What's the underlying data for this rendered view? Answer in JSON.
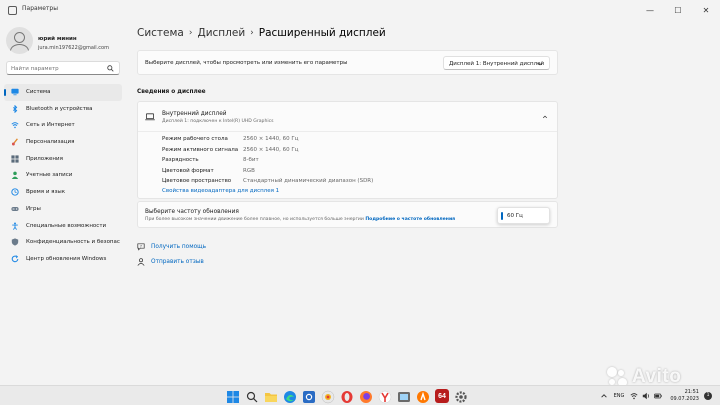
{
  "window": {
    "title": "Параметры",
    "controls": {
      "minimize": "—",
      "maximize": "☐",
      "close": "✕"
    }
  },
  "user": {
    "name": "юрий минин",
    "email": "jura.min197622@gmail.com"
  },
  "search": {
    "placeholder": "Найти параметр",
    "icon": "search-icon"
  },
  "sidebar": {
    "items": [
      {
        "label": "Система",
        "icon": "monitor-icon",
        "active": true
      },
      {
        "label": "Bluetooth и устройства",
        "icon": "bluetooth-icon"
      },
      {
        "label": "Сеть и Интернет",
        "icon": "wifi-icon"
      },
      {
        "label": "Персонализация",
        "icon": "brush-icon"
      },
      {
        "label": "Приложения",
        "icon": "apps-icon"
      },
      {
        "label": "Учетные записи",
        "icon": "person-icon"
      },
      {
        "label": "Время и язык",
        "icon": "globe-clock-icon"
      },
      {
        "label": "Игры",
        "icon": "gamepad-icon"
      },
      {
        "label": "Специальные возможности",
        "icon": "accessibility-icon"
      },
      {
        "label": "Конфиденциальность и безопас",
        "icon": "shield-icon"
      },
      {
        "label": "Центр обновления Windows",
        "icon": "update-icon"
      }
    ]
  },
  "breadcrumb": {
    "items": [
      "Система",
      "Дисплей"
    ],
    "current": "Расширенный дисплей",
    "separator": "›"
  },
  "display_select": {
    "prompt": "Выберите дисплей, чтобы просмотреть или изменить его параметры",
    "value": "Дисплей 1: Внутренний дисплей"
  },
  "display_info": {
    "section_title": "Сведения о дисплее",
    "title": "Внутренний дисплей",
    "subtitle": "Дисплей 1: подключен к Intel(R) UHD Graphics",
    "rows": [
      {
        "label": "Режим рабочего стола",
        "value": "2560 × 1440, 60 Гц"
      },
      {
        "label": "Режим активного сигнала",
        "value": "2560 × 1440, 60 Гц"
      },
      {
        "label": "Разрядность",
        "value": "8-бит"
      },
      {
        "label": "Цветовой формат",
        "value": "RGB"
      },
      {
        "label": "Цветовое пространство",
        "value": "Стандартный динамический диапазон (SDR)"
      }
    ],
    "adapter_link": "Свойства видеоадаптера для дисплея 1"
  },
  "refresh_rate": {
    "title": "Выберите частоту обновления",
    "description": "При более высоком значении движение более плавное, но используется больше энергии",
    "more_link": "Подробние о частоте обновления",
    "value": "60 Гц"
  },
  "help": {
    "get_help": "Получить помощь",
    "feedback": "Отправить отзыв"
  },
  "watermark": {
    "text": "Avito"
  },
  "taskbar": {
    "apps": [
      "windows-start-icon",
      "search-icon",
      "file-explorer-icon",
      "edge-icon",
      "settings-icon",
      "yandex-browser-icon",
      "opera-icon",
      "firefox-icon",
      "yandex-icon",
      "app-icon",
      "avast-icon",
      "badge-64-icon",
      "settings-gear-icon"
    ],
    "badge_64": "64",
    "language": "ENG",
    "time": "21:51",
    "date": "09.07.2023",
    "notifications": "1"
  },
  "colors": {
    "accent": "#0067c0",
    "background": "#f3f3f3",
    "card": "#fbfbfb"
  }
}
